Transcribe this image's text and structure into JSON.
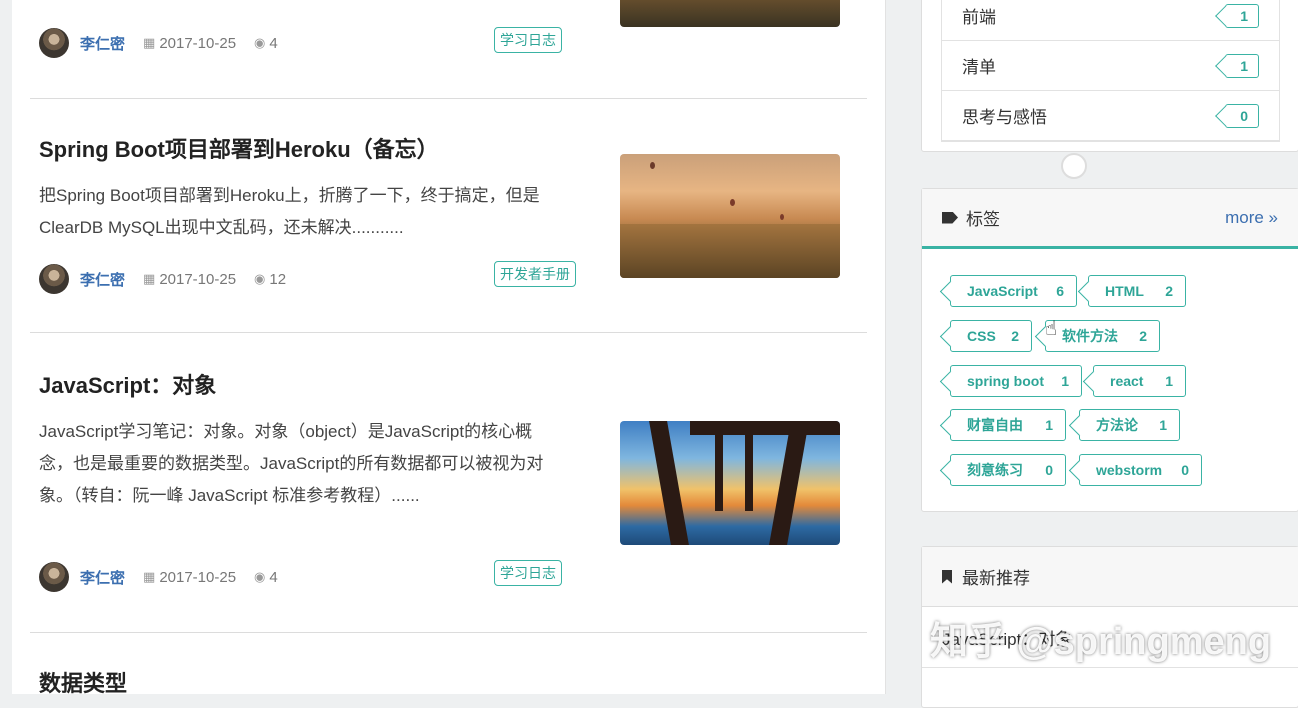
{
  "articles": [
    {
      "title": "",
      "excerpt": "",
      "author": "李仁密",
      "date": "2017-10-25",
      "views": "4",
      "category": "学习日志"
    },
    {
      "title": "Spring Boot项目部署到Heroku（备忘）",
      "excerpt": "把Spring Boot项目部署到Heroku上，折腾了一下，终于搞定，但是ClearDB MySQL出现中文乱码，还未解决...........",
      "author": "李仁密",
      "date": "2017-10-25",
      "views": "12",
      "category": "开发者手册"
    },
    {
      "title": "JavaScript：对象",
      "excerpt": "JavaScript学习笔记：对象。对象（object）是JavaScript的核心概念，也是最重要的数据类型。JavaScript的所有数据都可以被视为对象。（转自：阮一峰 JavaScript 标准参考教程）......",
      "author": "李仁密",
      "date": "2017-10-25",
      "views": "4",
      "category": "学习日志"
    },
    {
      "title": "数据类型"
    }
  ],
  "sidebar": {
    "categories": [
      {
        "name": "前端",
        "count": "1"
      },
      {
        "name": "清单",
        "count": "1"
      },
      {
        "name": "思考与感悟",
        "count": "0"
      }
    ],
    "tags_panel": {
      "title": "标签",
      "more": "more »",
      "tags": [
        {
          "name": "JavaScript",
          "count": "6"
        },
        {
          "name": "HTML",
          "count": "2"
        },
        {
          "name": "CSS",
          "count": "2"
        },
        {
          "name": "软件方法",
          "count": "2"
        },
        {
          "name": "spring boot",
          "count": "1"
        },
        {
          "name": "react",
          "count": "1"
        },
        {
          "name": "财富自由",
          "count": "1"
        },
        {
          "name": "方法论",
          "count": "1"
        },
        {
          "name": "刻意练习",
          "count": "0"
        },
        {
          "name": "webstorm",
          "count": "0"
        }
      ]
    },
    "recommend": {
      "title": "最新推荐",
      "items": [
        "JavaScript：对象"
      ]
    }
  },
  "watermark": "知乎 @springmeng"
}
